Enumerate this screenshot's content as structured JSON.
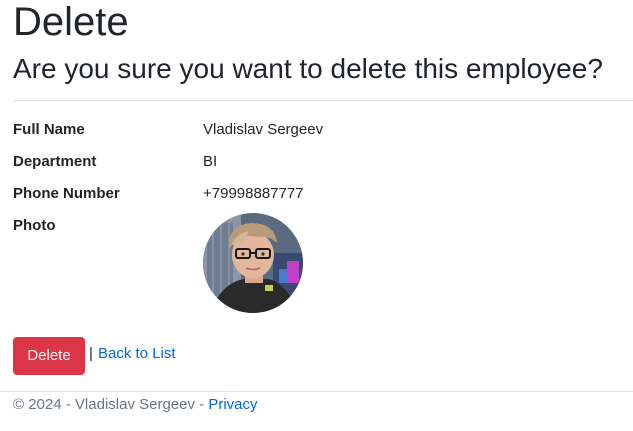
{
  "page": {
    "title": "Delete",
    "subtitle": "Are you sure you want to delete this employee?"
  },
  "details": [
    {
      "label": "Full Name",
      "value": "Vladislav Sergeev"
    },
    {
      "label": "Department",
      "value": "BI"
    },
    {
      "label": "Phone Number",
      "value": "+79998887777"
    },
    {
      "label": "Photo",
      "value": ""
    }
  ],
  "actions": {
    "delete_label": "Delete",
    "separator": "|",
    "back_label": "Back to List"
  },
  "footer": {
    "text": "© 2024 - Vladislav Sergeev - ",
    "privacy_label": "Privacy"
  },
  "colors": {
    "danger": "#dc3545",
    "link": "#0366d6",
    "muted": "#6c757d"
  }
}
